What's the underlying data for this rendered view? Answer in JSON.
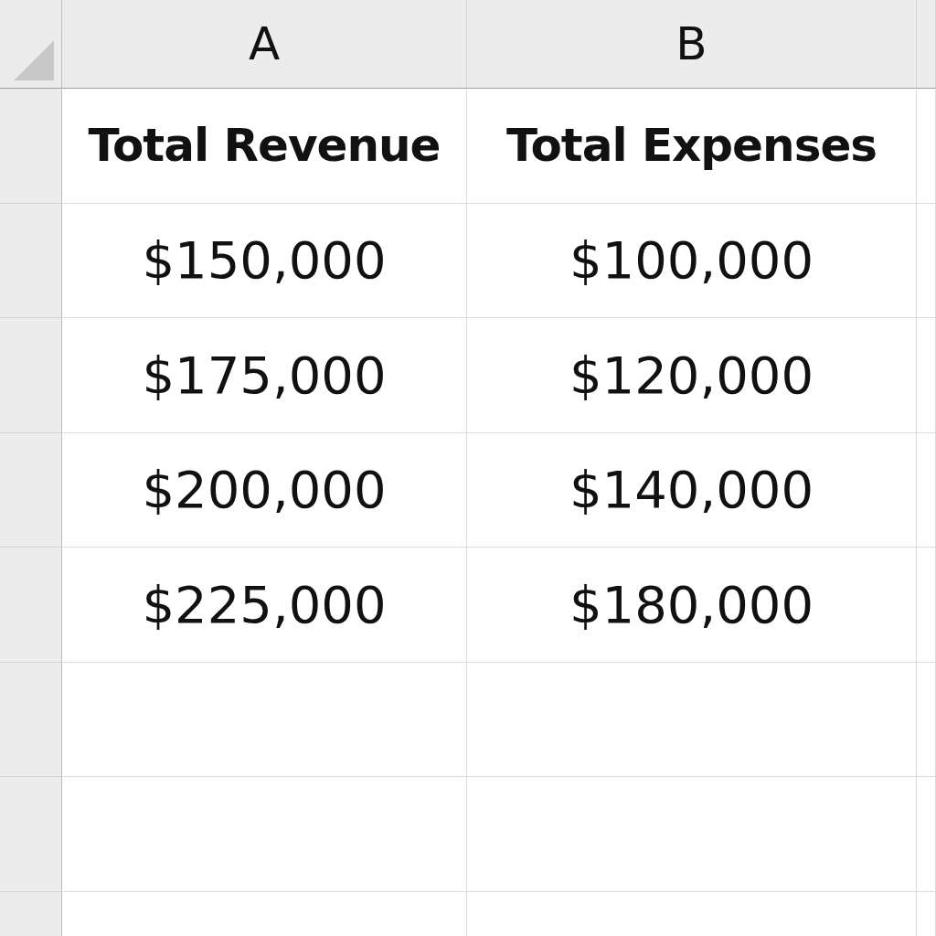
{
  "columns": [
    "A",
    "B"
  ],
  "rows": [
    {
      "kind": "header",
      "cells": [
        "Total Revenue",
        "Total Expenses"
      ]
    },
    {
      "kind": "value",
      "cells": [
        "$150,000",
        "$100,000"
      ]
    },
    {
      "kind": "value",
      "cells": [
        "$175,000",
        "$120,000"
      ]
    },
    {
      "kind": "value",
      "cells": [
        "$200,000",
        "$140,000"
      ]
    },
    {
      "kind": "value",
      "cells": [
        "$225,000",
        "$180,000"
      ]
    }
  ]
}
